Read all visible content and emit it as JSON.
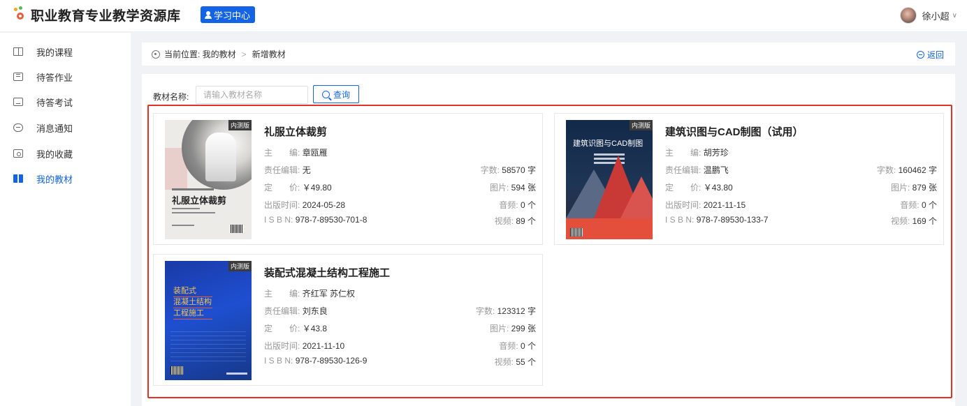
{
  "header": {
    "site_title": "职业教育专业教学资源库",
    "study_center": "学习中心",
    "user_name": "徐小超"
  },
  "sidebar": {
    "items": [
      {
        "label": "我的课程",
        "icon": "course-icon",
        "active": false
      },
      {
        "label": "待答作业",
        "icon": "homework-icon",
        "active": false
      },
      {
        "label": "待答考试",
        "icon": "exam-icon",
        "active": false
      },
      {
        "label": "消息通知",
        "icon": "message-icon",
        "active": false
      },
      {
        "label": "我的收藏",
        "icon": "favorite-icon",
        "active": false
      },
      {
        "label": "我的教材",
        "icon": "textbook-icon",
        "active": true
      }
    ]
  },
  "breadcrumb": {
    "prefix": "当前位置: 我的教材",
    "separator": ">",
    "current": "新增教材",
    "back": "返回"
  },
  "search": {
    "label": "教材名称:",
    "placeholder": "请输入教材名称",
    "button": "查询"
  },
  "labels": {
    "editor": "主　　编:",
    "resp_editor": "责任编辑:",
    "price": "定　　价:",
    "pub_date": "出版时间:",
    "isbn": "I S B N:",
    "words": "字数:",
    "images": "图片:",
    "audio": "音频:",
    "video": "视频:"
  },
  "books": [
    {
      "badge": "内测版",
      "title": "礼服立体裁剪",
      "cover_title": "礼服立体裁剪",
      "editor": "章瓯雁",
      "resp_editor": "无",
      "price": "￥49.80",
      "pub_date": "2024-05-28",
      "isbn": "978-7-89530-701-8",
      "words": "58570 字",
      "images": "594 张",
      "audio": "0 个",
      "video": "89 个"
    },
    {
      "badge": "内测版",
      "title": "建筑识图与CAD制图（试用）",
      "cover_title": "建筑识图与CAD制图",
      "editor": "胡芳珍",
      "resp_editor": "温鹏飞",
      "price": "￥43.80",
      "pub_date": "2021-11-15",
      "isbn": "978-7-89530-133-7",
      "words": "160462 字",
      "images": "879 张",
      "audio": "0 个",
      "video": "169 个"
    },
    {
      "badge": "内测版",
      "title": "装配式混凝土结构工程施工",
      "cover_title_lines": [
        "装配式",
        "混凝土结构",
        "工程施工"
      ],
      "editor": "齐红军 苏仁权",
      "resp_editor": "刘东良",
      "price": "￥43.8",
      "pub_date": "2021-11-10",
      "isbn": "978-7-89530-126-9",
      "words": "123312 字",
      "images": "299 张",
      "audio": "0 个",
      "video": "55 个"
    }
  ],
  "colors": {
    "primary": "#1463e5",
    "highlight_border": "#e5302a"
  }
}
